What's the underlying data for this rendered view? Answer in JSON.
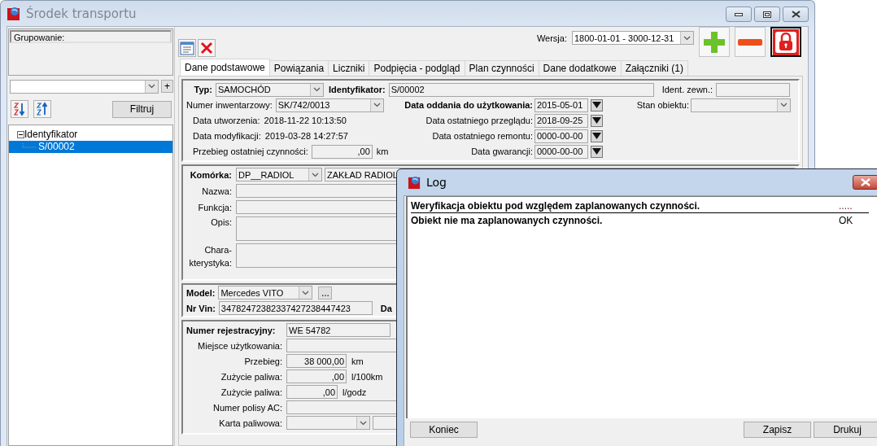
{
  "window": {
    "title": "Środek transportu"
  },
  "sidebar": {
    "grouping_label": "Grupowanie:",
    "add_button": "+",
    "filter_button": "Filtruj",
    "tree": [
      {
        "label": "Identyfikator",
        "expanded": true,
        "selected": false,
        "children": [
          {
            "label": "S/00002",
            "selected": true
          }
        ]
      }
    ]
  },
  "toolbar": {
    "version_label": "Wersja:",
    "version_value": "1800-01-01 - 3000-12-31"
  },
  "tabs": [
    {
      "label": "Dane podstawowe",
      "selected": true
    },
    {
      "label": "Powiązania",
      "selected": false
    },
    {
      "label": "Liczniki",
      "selected": false
    },
    {
      "label": "Podpięcia - podgląd",
      "selected": false
    },
    {
      "label": "Plan czynności",
      "selected": false
    },
    {
      "label": "Dane dodatkowe",
      "selected": false
    },
    {
      "label": "Załączniki (1)",
      "selected": false
    }
  ],
  "general": {
    "type": {
      "label": "Typ:",
      "value": "SAMOCHÓD"
    },
    "identifier": {
      "label": "Identyfikator:",
      "value": "S/00002"
    },
    "external_id": {
      "label": "Ident. zewn.:"
    },
    "inventory_number": {
      "label": "Numer inwentarzowy:",
      "value": "SK/742/0013"
    },
    "commissioning_date": {
      "label": "Data oddania do użytkowania:",
      "value": "2015-05-01"
    },
    "object_state": {
      "label": "Stan obiektu:"
    },
    "created": {
      "label": "Data utworzenia:",
      "value": "2018-11-22 10:13:50"
    },
    "last_inspection": {
      "label": "Data ostatniego przeglądu:",
      "value": "2018-09-25"
    },
    "modified": {
      "label": "Data modyfikacji:",
      "value": "2019-03-28 14:27:57"
    },
    "last_repair": {
      "label": "Data ostatniego remontu:",
      "value": "0000-00-00"
    },
    "last_mileage": {
      "label": "Przebieg ostatniej czynności:",
      "value": ",00",
      "unit": "km"
    },
    "warranty": {
      "label": "Data gwarancji:",
      "value": "0000-00-00"
    }
  },
  "unit": {
    "cell": {
      "label": "Komórka:",
      "code": "DP__RADIOL",
      "name": "ZAKŁAD RADIOL"
    },
    "name": {
      "label": "Nazwa:"
    },
    "function": {
      "label": "Funkcja:"
    },
    "description": {
      "label": "Opis:"
    },
    "characteristics": {
      "label": "Chara-\nkterystyka:"
    }
  },
  "model": {
    "model": {
      "label": "Model:",
      "value": "Mercedes VITO",
      "more_button": "..."
    },
    "vin": {
      "label": "Nr Vin:",
      "value": "34782472382337427238447423"
    },
    "column_3_label": "Da"
  },
  "registration": {
    "registration": {
      "label": "Numer rejestracyjny:",
      "value": "WE 54782"
    },
    "place": {
      "label": "Miejsce użytkowania:"
    },
    "mileage": {
      "label": "Przebieg:",
      "value": "38 000,00",
      "unit": "km"
    },
    "fuel_per_100": {
      "label": "Zużycie paliwa:",
      "value": ",00",
      "unit": "l/100km"
    },
    "fuel_per_hour": {
      "label": "Zużycie paliwa:",
      "value": ",00",
      "unit": "l/godz"
    },
    "policy": {
      "label": "Numer polisy AC:"
    },
    "fuel_card": {
      "label": "Karta paliwowa:"
    }
  },
  "log_dialog": {
    "title": "Log",
    "rows": [
      {
        "kind": "header",
        "text": "Weryfikacja obiektu pod względem zaplanowanych czynności.",
        "status": "....."
      },
      {
        "kind": "entry",
        "text": "Obiekt nie ma zaplanowanych czynności.",
        "status": "OK"
      }
    ],
    "buttons": [
      "Koniec",
      "Zapisz",
      "Drukuj"
    ]
  }
}
